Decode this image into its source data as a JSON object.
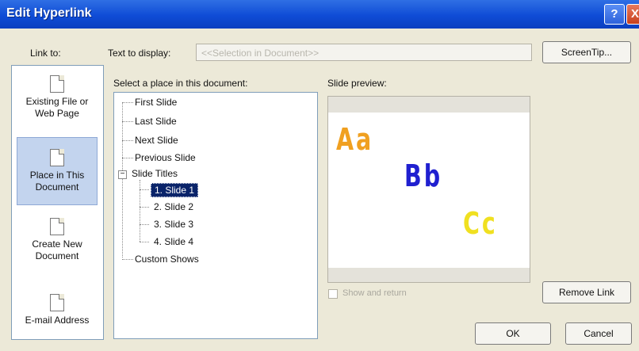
{
  "window": {
    "title": "Edit Hyperlink",
    "help_label": "?",
    "close_label": "X"
  },
  "link_to": {
    "label": "Link to:",
    "items": [
      {
        "label_line1": "Existing File or",
        "label_line2": "Web Page",
        "icon": "page-icon"
      },
      {
        "label_line1": "Place in This",
        "label_line2": "Document",
        "icon": "document-place-icon"
      },
      {
        "label_line1": "Create New",
        "label_line2": "Document",
        "icon": "new-document-icon"
      },
      {
        "label_line1": "E-mail Address",
        "label_line2": "",
        "icon": "email-icon"
      }
    ]
  },
  "text_to_display": {
    "label": "Text to display:",
    "value": "<<Selection in Document>>"
  },
  "screentip_button": "ScreenTip...",
  "place_section": {
    "label": "Select a place in this document:"
  },
  "tree": {
    "items": [
      "First Slide",
      "Last Slide",
      "Next Slide",
      "Previous Slide",
      "Slide Titles"
    ],
    "slides": [
      "1. Slide 1",
      "2. Slide 2",
      "3. Slide 3",
      "4. Slide 4"
    ],
    "custom_shows": "Custom Shows",
    "collapse_symbol": "−"
  },
  "preview": {
    "label": "Slide preview:",
    "glyphs": [
      {
        "text": "Aa",
        "color": "#f0a020"
      },
      {
        "text": "Bb",
        "color": "#2020d0"
      },
      {
        "text": "Cc",
        "color": "#f0e020"
      }
    ]
  },
  "show_and_return": {
    "label": "Show and return"
  },
  "buttons": {
    "remove_link": "Remove Link",
    "ok": "OK",
    "cancel": "Cancel"
  }
}
